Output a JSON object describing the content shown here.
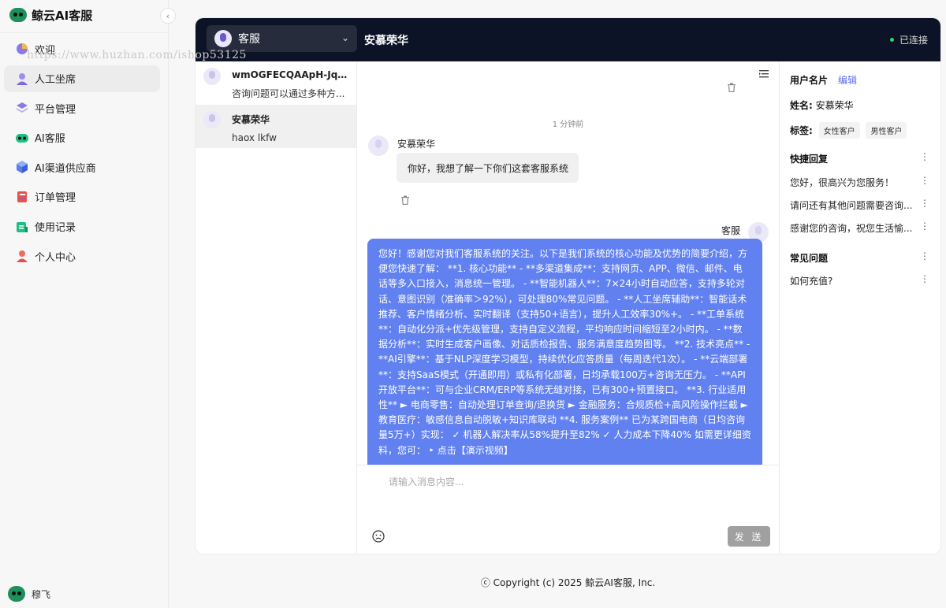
{
  "app": {
    "name": "鲸云AI客服"
  },
  "watermark": "https://www.huzhan.com/ishop53125",
  "sidebar": {
    "items": [
      {
        "label": "欢迎",
        "icon": "pie-chart-icon",
        "active": false
      },
      {
        "label": "人工坐席",
        "icon": "person-icon",
        "active": true
      },
      {
        "label": "平台管理",
        "icon": "layers-icon",
        "active": false
      },
      {
        "label": "AI客服",
        "icon": "robot-icon",
        "active": false
      },
      {
        "label": "AI渠道供应商",
        "icon": "cube-icon",
        "active": false
      },
      {
        "label": "订单管理",
        "icon": "order-icon",
        "active": false
      },
      {
        "label": "使用记录",
        "icon": "record-icon",
        "active": false
      },
      {
        "label": "个人中心",
        "icon": "user-center-icon",
        "active": false
      }
    ],
    "collapse_icon": "‹",
    "user_name": "穆飞"
  },
  "topbar": {
    "agent_label": "客服",
    "chevron": "⌄",
    "title": "安慕荣华",
    "status": "已连接",
    "status_color": "#3ccf6e"
  },
  "conversations": [
    {
      "name": "wmOGFECQAApH-Jqh...",
      "preview": "咨询问题可以通过多种方...",
      "active": false
    },
    {
      "name": "安慕荣华",
      "preview": "haox lkfw",
      "active": true
    }
  ],
  "chat": {
    "timestamp": "1 分钟前",
    "user_name": "安慕荣华",
    "user_message": "你好，我想了解一下你们这套客服系统",
    "agent_name": "客服",
    "agent_message": "您好！感谢您对我们客服系统的关注。以下是我们系统的核心功能及优势的简要介绍，方便您快速了解： **1. 核心功能** - **多渠道集成**：支持网页、APP、微信、邮件、电话等多入口接入，消息统一管理。 - **智能机器人**：7×24小时自动应答，支持多轮对话、意图识别（准确率＞92%），可处理80%常见问题。 - **人工坐席辅助**：智能话术推荐、客户情绪分析、实时翻译（支持50+语言），提升人工效率30%+。 - **工单系统**：自动化分派+优先级管理，支持自定义流程，平均响应时间缩短至2小时内。 - **数据分析**：实时生成客户画像、对话质检报告、服务满意度趋势图等。 **2. 技术亮点** - **AI引擎**：基于NLP深度学习模型，持续优化应答质量（每周迭代1次）。 - **云端部署**：支持SaaS模式（开通即用）或私有化部署，日均承载100万+咨询无压力。 - **API开放平台**：可与企业CRM/ERP等系统无缝对接，已有300+预置接口。 **3. 行业适用性** ► 电商零售：自动处理订单查询/退换货 ► 金融服务：合规质检+高风险操作拦截 ► 教育医疗：敏感信息自动脱敏+知识库联动 **4. 服务案例** 已为某跨国电商（日均咨询量5万+）实现： ✓ 机器人解决率从58%提升至82% ✓ 人力成本下降40% 如需更详细资料，您可： ‣ 点击【演示视频】"
  },
  "input": {
    "placeholder": "请输入消息内容...",
    "send_label": "发 送"
  },
  "right_panel": {
    "title": "用户名片",
    "edit_label": "编辑",
    "name_key": "姓名:",
    "name_value": "安慕荣华",
    "tags_key": "标签:",
    "tags": [
      "女性客户",
      "男性客户"
    ],
    "quick_reply_title": "快捷回复",
    "quick_replies": [
      "您好，很高兴为您服务！",
      "请问还有其他问题需要咨询...",
      "感谢您的咨询，祝您生活愉..."
    ],
    "faq_title": "常见问题",
    "faqs": [
      "如何充值?"
    ]
  },
  "footer": "ⓒ Copyright (c) 2025 鲸云AI客服, Inc."
}
